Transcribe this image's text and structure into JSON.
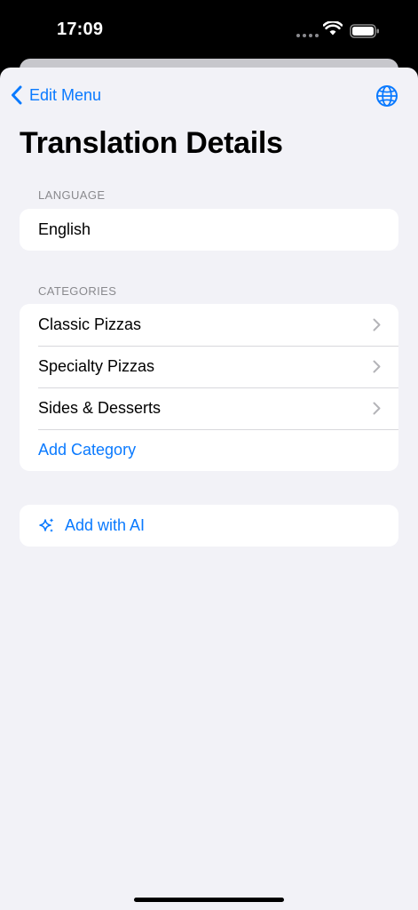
{
  "status_bar": {
    "time": "17:09"
  },
  "nav": {
    "back_label": "Edit Menu",
    "back_icon": "chevron-left-icon",
    "globe_icon": "globe-icon"
  },
  "page": {
    "title": "Translation Details"
  },
  "language_section": {
    "header": "LANGUAGE",
    "value": "English"
  },
  "categories_section": {
    "header": "CATEGORIES",
    "items": [
      {
        "label": "Classic Pizzas"
      },
      {
        "label": "Specialty Pizzas"
      },
      {
        "label": "Sides & Desserts"
      }
    ],
    "add_label": "Add Category"
  },
  "ai": {
    "label": "Add with AI",
    "icon": "sparkles-icon"
  },
  "colors": {
    "accent": "#0a7aff",
    "background": "#f2f2f7",
    "secondary_text": "#8a8a8e"
  }
}
